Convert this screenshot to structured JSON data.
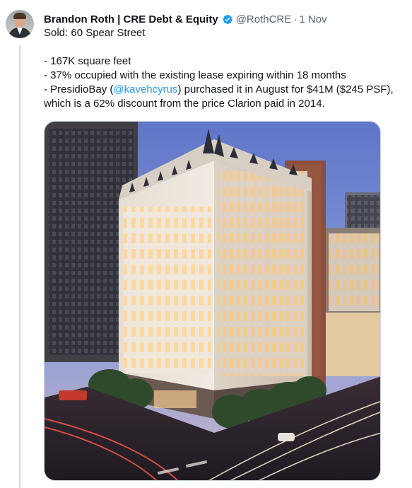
{
  "tweet": {
    "author_name": "Brandon Roth | CRE Debt & Equity",
    "handle": "@RothCRE",
    "separator": "·",
    "timestamp": "1 Nov",
    "lines": {
      "sold": "Sold: 60 Spear Street",
      "sqft": "- 167K square feet",
      "occupied": "- 37% occupied with the existing lease expiring within 18 months",
      "buyer_prefix": "- PresidioBay (",
      "buyer_mention": "@kavehcyrus",
      "buyer_suffix": ") purchased it in August for $41M ($245 PSF),",
      "discount": "which is a 62% discount from the price Clarion paid in 2014."
    },
    "icons": {
      "verified": "verified-badge-icon",
      "avatar": "user-avatar"
    },
    "colors": {
      "link": "#1d9bf0",
      "verified": "#1d9bf0",
      "secondary_text": "#536471"
    }
  }
}
